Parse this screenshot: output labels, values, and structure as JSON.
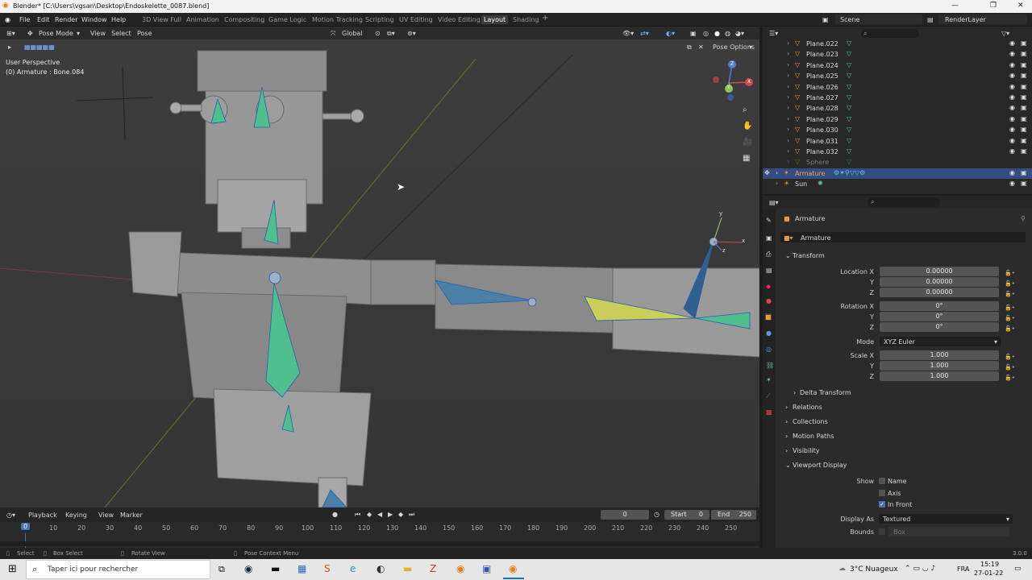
{
  "titlebar": {
    "title": "Blender* [C:\\Users\\vgsan\\Desktop\\Endoskelette_0087.blend]",
    "min": "—",
    "max": "❐",
    "close": "✕"
  },
  "menu": {
    "file": "File",
    "edit": "Edit",
    "render": "Render",
    "window": "Window",
    "help": "Help"
  },
  "workspaces": [
    "3D View Full",
    "Animation",
    "Compositing",
    "Game Logic",
    "Motion Tracking",
    "Scripting",
    "UV Editing",
    "Video Editing",
    "Layout",
    "Shading"
  ],
  "scene": {
    "label": "Scene",
    "renderlayer": "RenderLayer"
  },
  "viewport": {
    "mode": "Pose Mode",
    "view": "View",
    "select": "Select",
    "pose": "Pose",
    "orientation": "Global",
    "perspective": "User Perspective",
    "active": "(0) Armature : Bone.084",
    "pose_options": "Pose Options",
    "gizmo": {
      "x": "X",
      "y": "Y",
      "z": "Z"
    },
    "axis_x": "x",
    "axis_y": "y",
    "axis_z": "z"
  },
  "outliner": {
    "rows": [
      {
        "label": "Plane.022"
      },
      {
        "label": "Plane.023"
      },
      {
        "label": "Plane.024"
      },
      {
        "label": "Plane.025"
      },
      {
        "label": "Plane.026"
      },
      {
        "label": "Plane.027"
      },
      {
        "label": "Plane.028"
      },
      {
        "label": "Plane.029"
      },
      {
        "label": "Plane.030"
      },
      {
        "label": "Plane.031"
      },
      {
        "label": "Plane.032"
      },
      {
        "label": "Sphere"
      },
      {
        "label": "Armature"
      },
      {
        "label": "Sun"
      }
    ]
  },
  "properties": {
    "object_name": "Armature",
    "data_name": "Armature",
    "transform": "Transform",
    "location_x_lbl": "Location X",
    "y_lbl": "Y",
    "z_lbl": "Z",
    "loc_x": "0.00000",
    "loc_y": "0.00000",
    "loc_z": "0.00000",
    "rotation_x_lbl": "Rotation X",
    "rot_x": "0°",
    "rot_y": "0°",
    "rot_z": "0°",
    "mode_lbl": "Mode",
    "mode_val": "XYZ Euler",
    "scale_x_lbl": "Scale X",
    "scale_x": "1.000",
    "scale_y": "1.000",
    "scale_z": "1.000",
    "delta": "Delta Transform",
    "relations": "Relations",
    "collections": "Collections",
    "motion_paths": "Motion Paths",
    "visibility": "Visibility",
    "viewport_display": "Viewport Display",
    "show_lbl": "Show",
    "name": "Name",
    "axis": "Axis",
    "in_front": "In Front",
    "display_as_lbl": "Display As",
    "display_as": "Textured",
    "bounds_lbl": "Bounds",
    "bounds_val": "Box"
  },
  "timeline": {
    "playback": "Playback",
    "keying": "Keying",
    "view": "View",
    "marker": "Marker",
    "frame": "0",
    "start_lbl": "Start",
    "start": "0",
    "end_lbl": "End",
    "end": "250",
    "current": "0",
    "ticks": [
      "10",
      "20",
      "30",
      "40",
      "50",
      "60",
      "70",
      "80",
      "90",
      "100",
      "110",
      "120",
      "130",
      "140",
      "150",
      "160",
      "170",
      "180",
      "190",
      "200",
      "210",
      "220",
      "230",
      "240",
      "250"
    ]
  },
  "status": {
    "select": "Select",
    "box_select": "Box Select",
    "rotate_view": "Rotate View",
    "pose_context": "Pose Context Menu",
    "version": "3.0.0"
  },
  "taskbar": {
    "search_placeholder": "Taper ici pour rechercher",
    "weather": "3°C  Nuageux",
    "lang": "FRA",
    "time": "15:19",
    "date": "27-01-22"
  }
}
